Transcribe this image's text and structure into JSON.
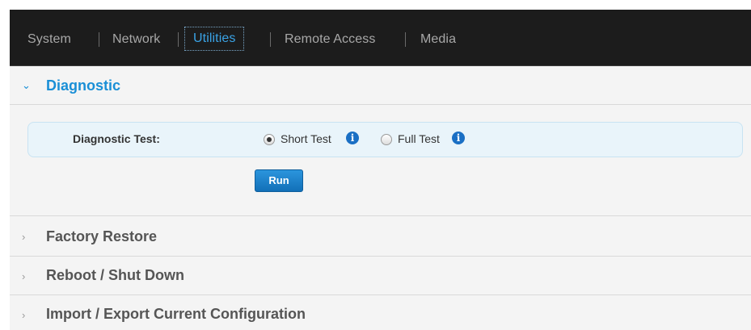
{
  "nav": {
    "items": [
      {
        "label": "System",
        "active": false
      },
      {
        "label": "Network",
        "active": false
      },
      {
        "label": "Utilities",
        "active": true
      },
      {
        "label": "Remote Access",
        "active": false
      },
      {
        "label": "Media",
        "active": false
      }
    ]
  },
  "sections": [
    {
      "title": "Diagnostic",
      "expanded": true
    },
    {
      "title": "Factory Restore",
      "expanded": false
    },
    {
      "title": "Reboot / Shut Down",
      "expanded": false
    },
    {
      "title": "Import / Export Current Configuration",
      "expanded": false
    }
  ],
  "diagnostic": {
    "test_label": "Diagnostic Test:",
    "options": [
      {
        "label": "Short Test",
        "selected": true
      },
      {
        "label": "Full Test",
        "selected": false
      }
    ],
    "run_label": "Run"
  },
  "colors": {
    "navbar_bg": "#1c1c1c",
    "accent": "#1a8fd6",
    "run_button": "#1a7fc9"
  },
  "icons": {
    "expanded": "chevron-down-icon",
    "collapsed": "chevron-right-icon",
    "info": "info-icon"
  }
}
